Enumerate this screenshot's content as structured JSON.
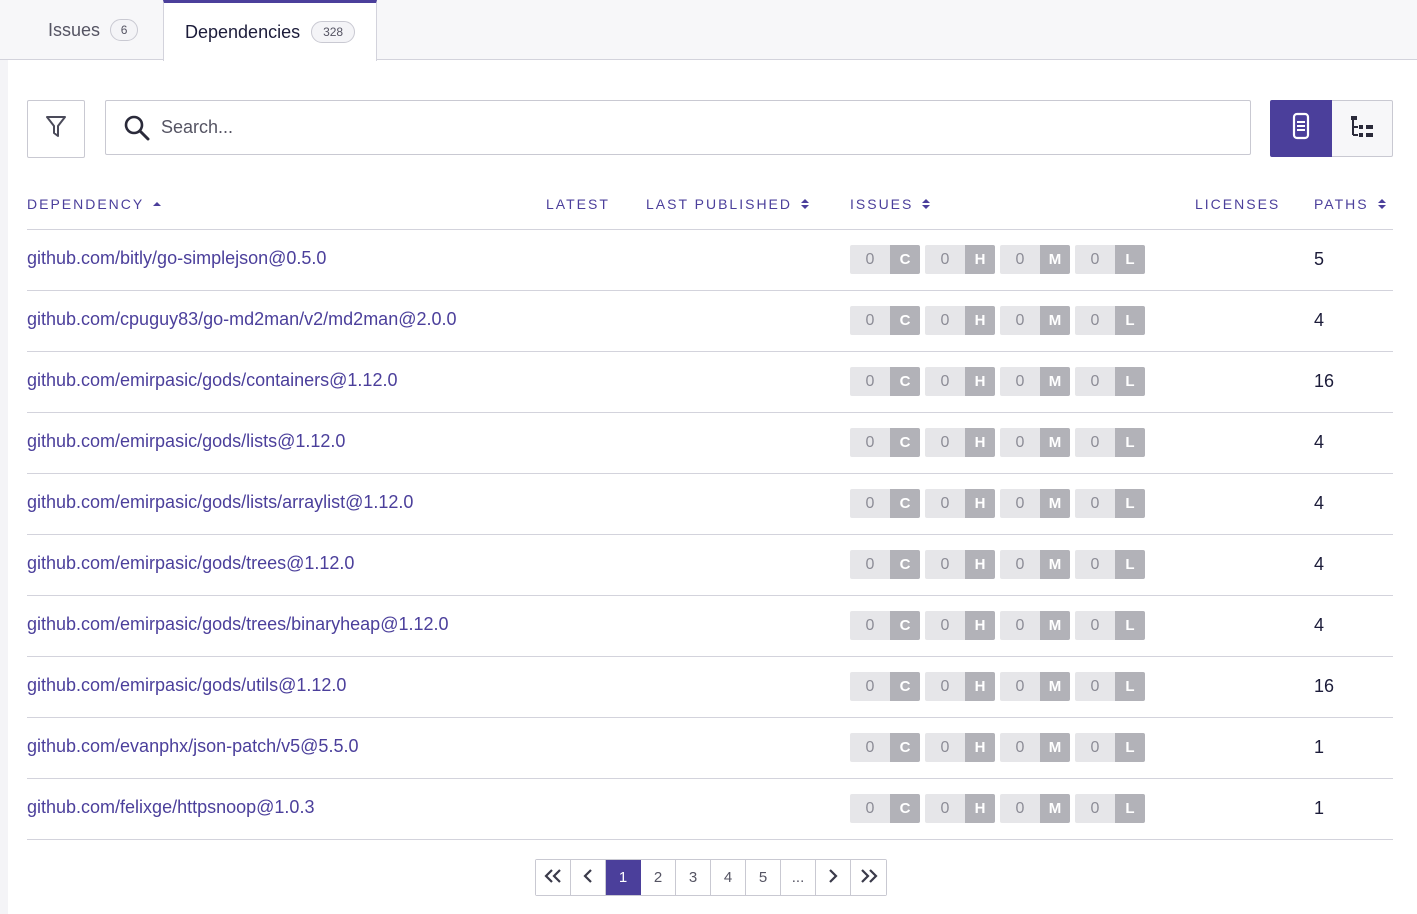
{
  "tabs": [
    {
      "label": "Issues",
      "count": "6"
    },
    {
      "label": "Dependencies",
      "count": "328"
    }
  ],
  "search": {
    "placeholder": "Search..."
  },
  "columns": {
    "dependency": "DEPENDENCY",
    "latest": "LATEST",
    "last_published": "LAST PUBLISHED",
    "issues": "ISSUES",
    "licenses": "LICENSES",
    "paths": "PATHS"
  },
  "severity_letters": [
    "C",
    "H",
    "M",
    "L"
  ],
  "rows": [
    {
      "name": "github.com/bitly/go-simplejson@0.5.0",
      "issues": [
        "0",
        "0",
        "0",
        "0"
      ],
      "paths": "5"
    },
    {
      "name": "github.com/cpuguy83/go-md2man/v2/md2man@2.0.0",
      "issues": [
        "0",
        "0",
        "0",
        "0"
      ],
      "paths": "4"
    },
    {
      "name": "github.com/emirpasic/gods/containers@1.12.0",
      "issues": [
        "0",
        "0",
        "0",
        "0"
      ],
      "paths": "16"
    },
    {
      "name": "github.com/emirpasic/gods/lists@1.12.0",
      "issues": [
        "0",
        "0",
        "0",
        "0"
      ],
      "paths": "4"
    },
    {
      "name": "github.com/emirpasic/gods/lists/arraylist@1.12.0",
      "issues": [
        "0",
        "0",
        "0",
        "0"
      ],
      "paths": "4"
    },
    {
      "name": "github.com/emirpasic/gods/trees@1.12.0",
      "issues": [
        "0",
        "0",
        "0",
        "0"
      ],
      "paths": "4"
    },
    {
      "name": "github.com/emirpasic/gods/trees/binaryheap@1.12.0",
      "issues": [
        "0",
        "0",
        "0",
        "0"
      ],
      "paths": "4"
    },
    {
      "name": "github.com/emirpasic/gods/utils@1.12.0",
      "issues": [
        "0",
        "0",
        "0",
        "0"
      ],
      "paths": "16"
    },
    {
      "name": "github.com/evanphx/json-patch/v5@5.5.0",
      "issues": [
        "0",
        "0",
        "0",
        "0"
      ],
      "paths": "1"
    },
    {
      "name": "github.com/felixge/httpsnoop@1.0.3",
      "issues": [
        "0",
        "0",
        "0",
        "0"
      ],
      "paths": "1"
    }
  ],
  "pagination": {
    "pages": [
      "1",
      "2",
      "3",
      "4",
      "5",
      "..."
    ],
    "current": "1"
  },
  "colors": {
    "accent": "#4b3f9b",
    "badge_num_bg": "#e6e6e9",
    "badge_letter_bg": "#b2b2b8"
  },
  "icons": {
    "filter": "filter-icon",
    "search": "search-icon",
    "list_view": "list-view-icon",
    "tree_view": "tree-view-icon"
  }
}
